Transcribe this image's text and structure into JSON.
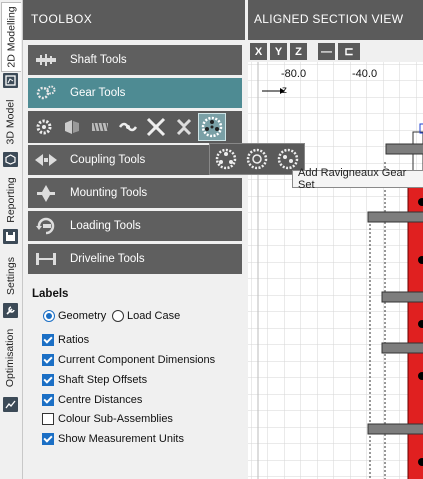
{
  "side_tabs": [
    {
      "label": "2D Modelling",
      "icon": "model-2d-icon"
    },
    {
      "label": "3D Model",
      "icon": "model-3d-icon"
    },
    {
      "label": "Reporting",
      "icon": "save-icon"
    },
    {
      "label": "Settings",
      "icon": "wrench-icon"
    },
    {
      "label": "Optimisation",
      "icon": "chart-icon"
    }
  ],
  "toolbox": {
    "title": "TOOLBOX",
    "tools": [
      {
        "label": "Shaft Tools",
        "icon": "shaft-tools-icon"
      },
      {
        "label": "Gear Tools",
        "icon": "gear-tools-icon"
      },
      {
        "label": "Coupling Tools",
        "icon": "coupling-tools-icon"
      },
      {
        "label": "Mounting Tools",
        "icon": "mounting-tools-icon"
      },
      {
        "label": "Loading Tools",
        "icon": "loading-tools-icon"
      },
      {
        "label": "Driveline Tools",
        "icon": "driveline-tools-icon"
      }
    ],
    "gear_subtools": [
      "cylindrical-gear-icon",
      "bevel-gear-icon",
      "worm-gear-icon",
      "spiral-gear-icon",
      "planetary-gear-icon",
      "ravigneaux-gear-icon"
    ]
  },
  "gear_popup": {
    "options": [
      "ravigneaux-gear-set-icon",
      "compound-planetary-icon",
      "double-planetary-icon"
    ],
    "tooltip": "Add Ravigneaux Gear Set"
  },
  "labels": {
    "title": "Labels",
    "radio": [
      {
        "label": "Geometry",
        "selected": true
      },
      {
        "label": "Load Case",
        "selected": false
      }
    ],
    "checkboxes": [
      {
        "label": "Ratios",
        "checked": true
      },
      {
        "label": "Current Component Dimensions",
        "checked": true
      },
      {
        "label": "Shaft Step Offsets",
        "checked": true
      },
      {
        "label": "Centre Distances",
        "checked": true
      },
      {
        "label": "Colour Sub-Assemblies",
        "checked": false
      },
      {
        "label": "Show Measurement Units",
        "checked": true
      }
    ]
  },
  "view": {
    "title": "ALIGNED SECTION VIEW",
    "toolbar": [
      "X",
      "Y",
      "Z",
      "—",
      "⊏"
    ],
    "axis_ticks": [
      "-80.0",
      "-40.0"
    ],
    "axis_label": "z",
    "colors": {
      "shaft": "#e02020",
      "component": "#808080",
      "grid": "#d0d0d0"
    }
  }
}
